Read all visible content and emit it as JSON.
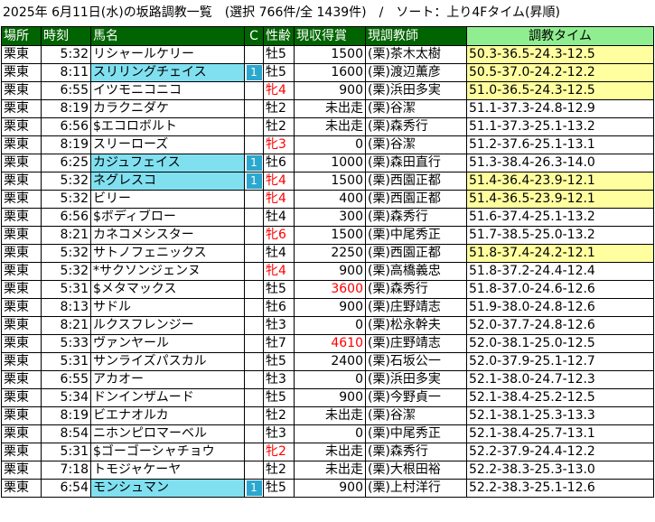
{
  "title": "2025年 6月11日(水)の坂路調教一覧　(選択 766件/全 1439件)　/　ソート：上り4Fタイム(昇順)",
  "headers": {
    "place": "場所",
    "clock": "時刻",
    "name": "馬名",
    "c": "C",
    "sex_age": "性齢",
    "prize": "現収得賞",
    "trainer": "現調教師",
    "times": "調教タイム"
  },
  "colors": {
    "header_bg": "#006400",
    "time_header_bg": "#90ee90",
    "name_highlight": "#80e0f0",
    "time_highlight": "#ffffa0",
    "female_red": "#ff0000"
  },
  "rows": [
    {
      "place": "栗東",
      "clock": "5:32",
      "name": "リシャールケリー",
      "c": "",
      "sex_age": "牡5",
      "sex_red": false,
      "prize": "1500",
      "prize_red": false,
      "trainer": "(栗)茶木太樹",
      "times": "50.3-36.5-24.3-12.5",
      "times_hl": true,
      "name_hl": false
    },
    {
      "place": "栗東",
      "clock": "8:11",
      "name": "スリリングチェイス",
      "c": "1",
      "sex_age": "牡5",
      "sex_red": false,
      "prize": "1600",
      "prize_red": false,
      "trainer": "(栗)渡辺薫彦",
      "times": "50.5-37.0-24.2-12.2",
      "times_hl": true,
      "name_hl": true
    },
    {
      "place": "栗東",
      "clock": "6:55",
      "name": "イツモニコニコ",
      "c": "",
      "sex_age": "牝4",
      "sex_red": true,
      "prize": "900",
      "prize_red": false,
      "trainer": "(栗)浜田多実",
      "times": "51.0-36.5-24.3-12.5",
      "times_hl": true,
      "name_hl": false
    },
    {
      "place": "栗東",
      "clock": "8:19",
      "name": "カラクニダケ",
      "c": "",
      "sex_age": "牡2",
      "sex_red": false,
      "prize": "未出走",
      "prize_red": false,
      "trainer": "(栗)谷潔",
      "times": "51.1-37.3-24.8-12.9",
      "times_hl": false,
      "name_hl": false
    },
    {
      "place": "栗東",
      "clock": "6:56",
      "name": "$エコロボルト",
      "c": "",
      "sex_age": "牡2",
      "sex_red": false,
      "prize": "未出走",
      "prize_red": false,
      "trainer": "(栗)森秀行",
      "times": "51.1-37.3-25.1-13.2",
      "times_hl": false,
      "name_hl": false
    },
    {
      "place": "栗東",
      "clock": "8:19",
      "name": "スリーローズ",
      "c": "",
      "sex_age": "牝3",
      "sex_red": true,
      "prize": "0",
      "prize_red": false,
      "trainer": "(栗)谷潔",
      "times": "51.2-37.6-25.1-13.1",
      "times_hl": false,
      "name_hl": false
    },
    {
      "place": "栗東",
      "clock": "6:25",
      "name": "カジュフェイス",
      "c": "1",
      "sex_age": "牡6",
      "sex_red": false,
      "prize": "1000",
      "prize_red": false,
      "trainer": "(栗)森田直行",
      "times": "51.3-38.4-26.3-14.0",
      "times_hl": false,
      "name_hl": true
    },
    {
      "place": "栗東",
      "clock": "5:32",
      "name": "ネグレスコ",
      "c": "1",
      "sex_age": "牝4",
      "sex_red": true,
      "prize": "1500",
      "prize_red": false,
      "trainer": "(栗)西園正都",
      "times": "51.4-36.4-23.9-12.1",
      "times_hl": true,
      "name_hl": true
    },
    {
      "place": "栗東",
      "clock": "5:32",
      "name": "ビリー",
      "c": "",
      "sex_age": "牝4",
      "sex_red": true,
      "prize": "400",
      "prize_red": false,
      "trainer": "(栗)西園正都",
      "times": "51.4-36.5-23.9-12.1",
      "times_hl": true,
      "name_hl": false
    },
    {
      "place": "栗東",
      "clock": "6:56",
      "name": "$ボディブロー",
      "c": "",
      "sex_age": "牡4",
      "sex_red": false,
      "prize": "300",
      "prize_red": false,
      "trainer": "(栗)森秀行",
      "times": "51.6-37.4-25.1-13.2",
      "times_hl": false,
      "name_hl": false
    },
    {
      "place": "栗東",
      "clock": "8:21",
      "name": "カネコメシスター",
      "c": "",
      "sex_age": "牝6",
      "sex_red": true,
      "prize": "1500",
      "prize_red": false,
      "trainer": "(栗)中尾秀正",
      "times": "51.7-38.5-25.0-13.2",
      "times_hl": false,
      "name_hl": false
    },
    {
      "place": "栗東",
      "clock": "5:32",
      "name": "サトノフェニックス",
      "c": "",
      "sex_age": "牡4",
      "sex_red": false,
      "prize": "2250",
      "prize_red": false,
      "trainer": "(栗)西園正都",
      "times": "51.8-37.4-24.2-12.1",
      "times_hl": true,
      "name_hl": false
    },
    {
      "place": "栗東",
      "clock": "5:32",
      "name": "*サクソンジェンヌ",
      "c": "",
      "sex_age": "牝4",
      "sex_red": true,
      "prize": "900",
      "prize_red": false,
      "trainer": "(栗)高橋義忠",
      "times": "51.8-37.2-24.4-12.4",
      "times_hl": false,
      "name_hl": false
    },
    {
      "place": "栗東",
      "clock": "5:31",
      "name": "$メタマックス",
      "c": "",
      "sex_age": "牡5",
      "sex_red": false,
      "prize": "3600",
      "prize_red": true,
      "trainer": "(栗)森秀行",
      "times": "51.8-37.0-24.6-12.6",
      "times_hl": false,
      "name_hl": false
    },
    {
      "place": "栗東",
      "clock": "8:13",
      "name": "サドル",
      "c": "",
      "sex_age": "牡6",
      "sex_red": false,
      "prize": "900",
      "prize_red": false,
      "trainer": "(栗)庄野靖志",
      "times": "51.9-38.0-24.8-12.6",
      "times_hl": false,
      "name_hl": false
    },
    {
      "place": "栗東",
      "clock": "8:21",
      "name": "ルクスフレンジー",
      "c": "",
      "sex_age": "牡3",
      "sex_red": false,
      "prize": "0",
      "prize_red": false,
      "trainer": "(栗)松永幹夫",
      "times": "52.0-37.7-24.8-12.6",
      "times_hl": false,
      "name_hl": false
    },
    {
      "place": "栗東",
      "clock": "5:33",
      "name": "ヴァンヤール",
      "c": "",
      "sex_age": "牡7",
      "sex_red": false,
      "prize": "4610",
      "prize_red": true,
      "trainer": "(栗)庄野靖志",
      "times": "52.0-38.1-25.0-12.5",
      "times_hl": false,
      "name_hl": false
    },
    {
      "place": "栗東",
      "clock": "5:31",
      "name": "サンライズパスカル",
      "c": "",
      "sex_age": "牡5",
      "sex_red": false,
      "prize": "2400",
      "prize_red": false,
      "trainer": "(栗)石坂公一",
      "times": "52.0-37.9-25.1-12.7",
      "times_hl": false,
      "name_hl": false
    },
    {
      "place": "栗東",
      "clock": "6:55",
      "name": "アカオー",
      "c": "",
      "sex_age": "牡3",
      "sex_red": false,
      "prize": "0",
      "prize_red": false,
      "trainer": "(栗)浜田多実",
      "times": "52.1-38.0-24.7-12.3",
      "times_hl": false,
      "name_hl": false
    },
    {
      "place": "栗東",
      "clock": "5:34",
      "name": "ドンインザムード",
      "c": "",
      "sex_age": "牡5",
      "sex_red": false,
      "prize": "900",
      "prize_red": false,
      "trainer": "(栗)今野貞一",
      "times": "52.1-38.4-25.2-12.5",
      "times_hl": false,
      "name_hl": false
    },
    {
      "place": "栗東",
      "clock": "8:19",
      "name": "ビエナオルカ",
      "c": "",
      "sex_age": "牡2",
      "sex_red": false,
      "prize": "未出走",
      "prize_red": false,
      "trainer": "(栗)谷潔",
      "times": "52.1-38.1-25.3-13.3",
      "times_hl": false,
      "name_hl": false
    },
    {
      "place": "栗東",
      "clock": "8:54",
      "name": "ニホンピロマーベル",
      "c": "",
      "sex_age": "牡3",
      "sex_red": false,
      "prize": "0",
      "prize_red": false,
      "trainer": "(栗)中尾秀正",
      "times": "52.1-38.4-25.7-13.1",
      "times_hl": false,
      "name_hl": false
    },
    {
      "place": "栗東",
      "clock": "5:31",
      "name": "$ゴーゴーシャチョウ",
      "c": "",
      "sex_age": "牝2",
      "sex_red": true,
      "prize": "未出走",
      "prize_red": false,
      "trainer": "(栗)森秀行",
      "times": "52.2-37.9-24.4-12.2",
      "times_hl": false,
      "name_hl": false
    },
    {
      "place": "栗東",
      "clock": "7:18",
      "name": "トモジャケーヤ",
      "c": "",
      "sex_age": "牡2",
      "sex_red": false,
      "prize": "未出走",
      "prize_red": false,
      "trainer": "(栗)大根田裕",
      "times": "52.2-38.3-25.3-13.0",
      "times_hl": false,
      "name_hl": false
    },
    {
      "place": "栗東",
      "clock": "6:54",
      "name": "モンシュマン",
      "c": "1",
      "sex_age": "牡5",
      "sex_red": false,
      "prize": "900",
      "prize_red": false,
      "trainer": "(栗)上村洋行",
      "times": "52.2-38.3-25.1-12.6",
      "times_hl": false,
      "name_hl": true
    }
  ]
}
